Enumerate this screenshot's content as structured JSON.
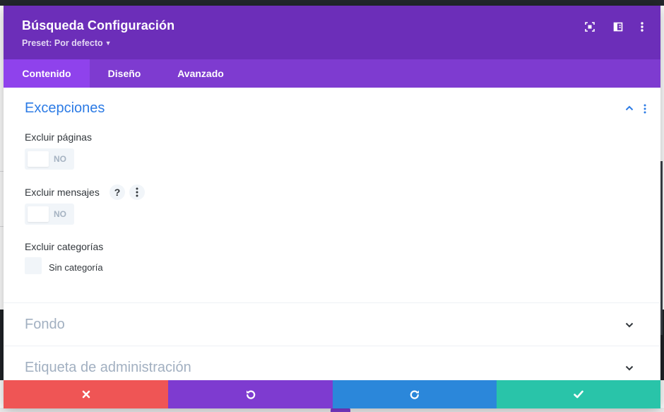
{
  "modal": {
    "title": "Búsqueda Configuración",
    "preset_label": "Preset: Por defecto",
    "header_icons": [
      "expand-icon",
      "split-view-icon",
      "more-options-icon"
    ]
  },
  "tabs": [
    {
      "label": "Contenido",
      "active": true
    },
    {
      "label": "Diseño",
      "active": false
    },
    {
      "label": "Avanzado",
      "active": false
    }
  ],
  "sections": {
    "exceptions": {
      "title": "Excepciones",
      "expanded": true,
      "fields": {
        "exclude_pages": {
          "label": "Excluir páginas",
          "toggle_value": "NO"
        },
        "exclude_posts": {
          "label": "Excluir mensajes",
          "help_glyph": "?",
          "toggle_value": "NO"
        },
        "exclude_categories": {
          "label": "Excluir categorías",
          "option_label": "Sin categoría"
        }
      }
    },
    "background": {
      "title": "Fondo",
      "expanded": false
    },
    "admin_label": {
      "title": "Etiqueta de administración",
      "expanded": false
    }
  },
  "footer": {
    "buttons": [
      {
        "name": "discard",
        "icon": "close-icon",
        "color": "#ef5555"
      },
      {
        "name": "undo",
        "icon": "undo-icon",
        "color": "#7e3bd0"
      },
      {
        "name": "redo",
        "icon": "redo-icon",
        "color": "#2b87da"
      },
      {
        "name": "save",
        "icon": "check-icon",
        "color": "#29c4a9"
      }
    ]
  },
  "colors": {
    "header": "#6c2eb9",
    "tabs": "#7e3bd0",
    "active_tab": "#8f42ec",
    "section_open": "#2c7be5",
    "section_closed": "#a2b0c1"
  }
}
